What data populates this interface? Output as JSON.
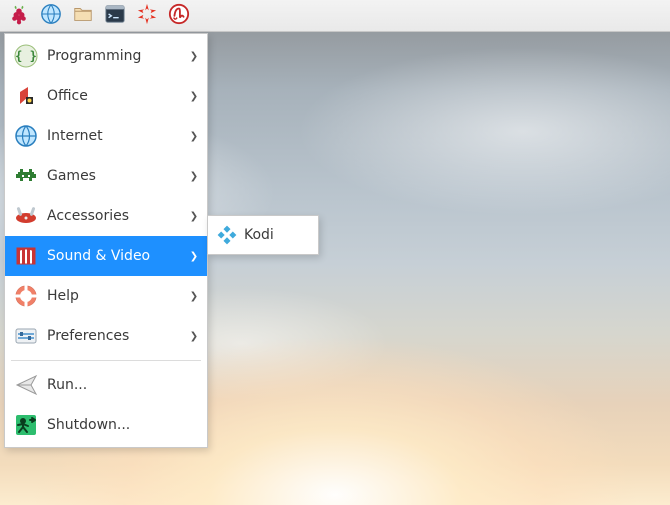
{
  "panel": {
    "launchers": [
      {
        "name": "menu-button",
        "icon": "raspberry-icon"
      },
      {
        "name": "web-browser-launcher",
        "icon": "globe-icon"
      },
      {
        "name": "file-manager-launcher",
        "icon": "folder-icon"
      },
      {
        "name": "terminal-launcher",
        "icon": "terminal-icon"
      },
      {
        "name": "mathematica-launcher",
        "icon": "spikey-icon"
      },
      {
        "name": "wolfram-launcher",
        "icon": "wolfram-icon"
      }
    ]
  },
  "menu": {
    "items": [
      {
        "label": "Programming",
        "icon": "programming-icon",
        "has_submenu": true
      },
      {
        "label": "Office",
        "icon": "office-icon",
        "has_submenu": true
      },
      {
        "label": "Internet",
        "icon": "internet-icon",
        "has_submenu": true
      },
      {
        "label": "Games",
        "icon": "games-icon",
        "has_submenu": true
      },
      {
        "label": "Accessories",
        "icon": "accessories-icon",
        "has_submenu": true
      },
      {
        "label": "Sound & Video",
        "icon": "soundvideo-icon",
        "has_submenu": true,
        "highlight": true
      },
      {
        "label": "Help",
        "icon": "help-icon",
        "has_submenu": true
      },
      {
        "label": "Preferences",
        "icon": "preferences-icon",
        "has_submenu": true
      },
      {
        "label": "Run...",
        "icon": "run-icon",
        "has_submenu": false
      },
      {
        "label": "Shutdown...",
        "icon": "shutdown-icon",
        "has_submenu": false
      }
    ],
    "separators_after": [
      7
    ]
  },
  "submenu": {
    "parent": "Sound & Video",
    "items": [
      {
        "label": "Kodi",
        "icon": "kodi-icon"
      }
    ]
  },
  "colors": {
    "highlight": "#1e90ff",
    "panel_bg": "#ececec",
    "menu_bg": "#ffffff",
    "text": "#3a3a3a"
  }
}
